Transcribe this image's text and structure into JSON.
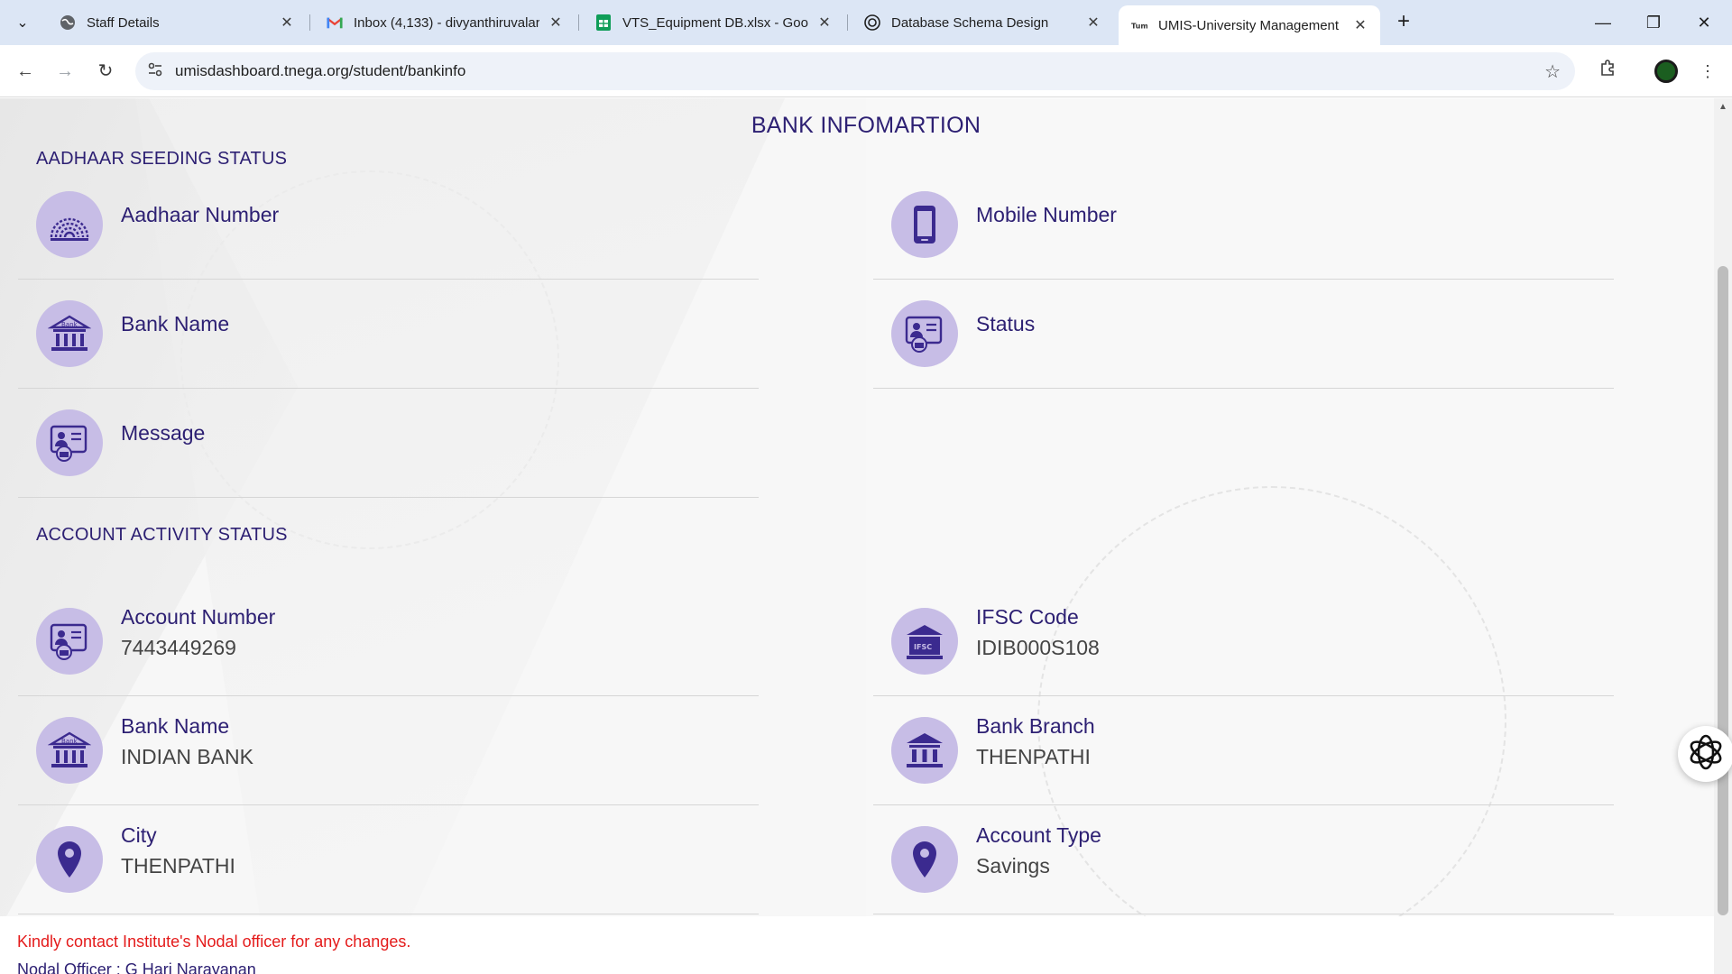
{
  "browser": {
    "tabs": [
      {
        "title": "Staff Details",
        "icon": "globe-icon"
      },
      {
        "title": "Inbox (4,133) - divyanthiruvalar",
        "icon": "gmail-icon"
      },
      {
        "title": "VTS_Equipment DB.xlsx - Googl",
        "icon": "sheets-icon"
      },
      {
        "title": "Database Schema Design",
        "icon": "openai-icon"
      },
      {
        "title": "UMIS-University Management",
        "icon": "umis-icon"
      }
    ],
    "url": "umisdashboard.tnega.org/student/bankinfo"
  },
  "page": {
    "title": "BANK INFOMARTION",
    "aadhaar_section": {
      "title": "AADHAAR SEEDING STATUS",
      "fields": {
        "aadhaar_number": {
          "label": "Aadhaar Number",
          "value": ""
        },
        "mobile_number": {
          "label": "Mobile Number",
          "value": ""
        },
        "bank_name": {
          "label": "Bank Name",
          "value": ""
        },
        "status": {
          "label": "Status",
          "value": ""
        },
        "message": {
          "label": "Message",
          "value": ""
        }
      }
    },
    "account_section": {
      "title": "ACCOUNT ACTIVITY STATUS",
      "fields": {
        "account_number": {
          "label": "Account Number",
          "value": "7443449269"
        },
        "ifsc_code": {
          "label": "IFSC Code",
          "value": "IDIB000S108"
        },
        "bank_name": {
          "label": "Bank Name",
          "value": "INDIAN BANK"
        },
        "bank_branch": {
          "label": "Bank Branch",
          "value": "THENPATHI"
        },
        "city": {
          "label": "City",
          "value": "THENPATHI"
        },
        "account_type": {
          "label": "Account Type",
          "value": "Savings"
        }
      }
    },
    "notice": "Kindly contact Institute's Nodal officer for any changes.",
    "nodal_officer": "Nodal Officer : G Hari Narayanan"
  },
  "colors": {
    "heading": "#2d2073",
    "icon_bg": "#c7bde6",
    "icon_fg": "#3b2a8f",
    "notice": "#e41b1b",
    "tab_bar": "#dce6f5"
  }
}
